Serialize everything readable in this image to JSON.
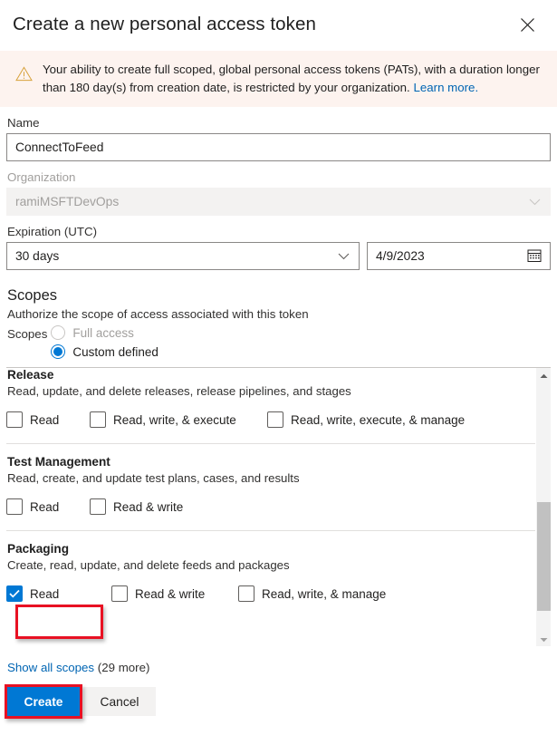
{
  "dialog": {
    "title": "Create a new personal access token",
    "close_icon": "close-icon"
  },
  "banner": {
    "icon": "warning-triangle-icon",
    "text": "Your ability to create full scoped, global personal access tokens (PATs), with a duration longer than 180 day(s) from creation date, is restricted by your organization. ",
    "link_text": "Learn more.",
    "background": "#fdf3ef",
    "icon_color": "#d8a23c",
    "link_color": "#0065b3"
  },
  "form": {
    "name": {
      "label": "Name",
      "value": "ConnectToFeed",
      "placeholder": ""
    },
    "organization": {
      "label": "Organization",
      "value": "ramiMSFTDevOps",
      "disabled": true,
      "chevron_icon": "chevron-down-icon"
    },
    "expiration": {
      "label": "Expiration (UTC)",
      "duration_value": "30 days",
      "date_value": "4/9/2023",
      "chevron_icon": "chevron-down-icon",
      "calendar_icon": "calendar-icon"
    }
  },
  "scopes": {
    "title": "Scopes",
    "subtitle": "Authorize the scope of access associated with this token",
    "radio_label": "Scopes",
    "options": [
      {
        "label": "Full access",
        "selected": false,
        "disabled": true
      },
      {
        "label": "Custom defined",
        "selected": true,
        "disabled": false
      }
    ],
    "groups": [
      {
        "name": "Release",
        "description": "Read, update, and delete releases, release pipelines, and stages",
        "checkboxes": [
          {
            "label": "Read",
            "checked": false
          },
          {
            "label": "Read, write, & execute",
            "checked": false
          },
          {
            "label": "Read, write, execute, & manage",
            "checked": false
          }
        ]
      },
      {
        "name": "Test Management",
        "description": "Read, create, and update test plans, cases, and results",
        "checkboxes": [
          {
            "label": "Read",
            "checked": false
          },
          {
            "label": "Read & write",
            "checked": false
          }
        ]
      },
      {
        "name": "Packaging",
        "description": "Create, read, update, and delete feeds and packages",
        "checkboxes": [
          {
            "label": "Read",
            "checked": true
          },
          {
            "label": "Read & write",
            "checked": false
          },
          {
            "label": "Read, write, & manage",
            "checked": false
          }
        ]
      }
    ],
    "scrollbar": {
      "up_arrow_icon": "scroll-up-arrow-icon",
      "down_arrow_icon": "scroll-down-arrow-icon"
    }
  },
  "show_all_scopes": {
    "link_text": "Show all scopes",
    "count_text": "(29 more)"
  },
  "footer": {
    "create_label": "Create",
    "cancel_label": "Cancel",
    "primary_color": "#0078d4"
  },
  "annotations": {
    "color": "#e81123"
  }
}
